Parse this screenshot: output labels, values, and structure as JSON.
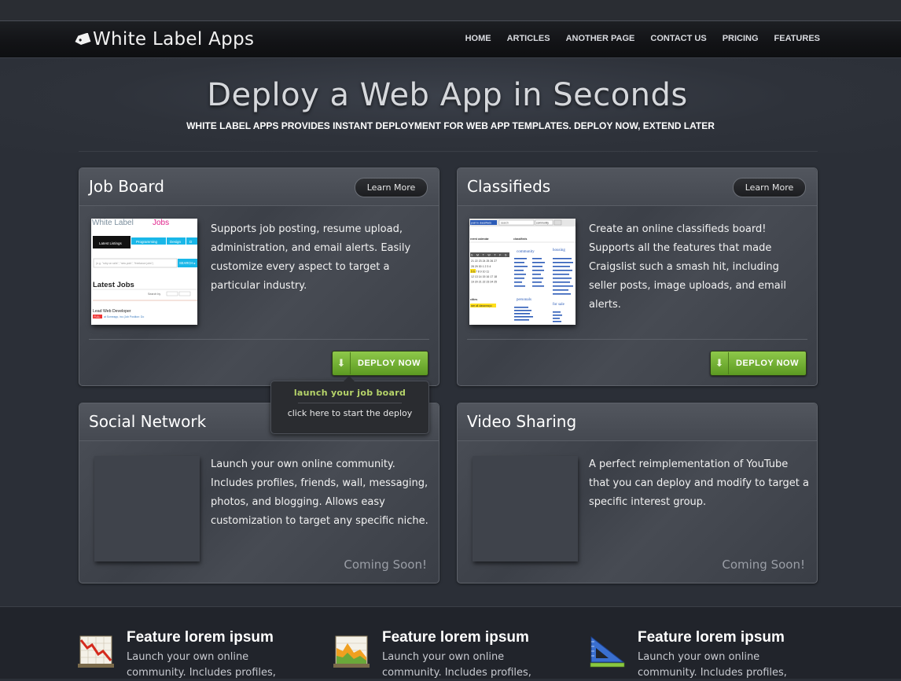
{
  "brand": {
    "name": "White Label Apps",
    "icon": "tag-icon"
  },
  "nav": {
    "items": [
      "HOME",
      "ARTICLES",
      "ANOTHER PAGE",
      "CONTACT US",
      "PRICING",
      "FEATURES"
    ]
  },
  "hero": {
    "title": "Deploy a Web App in Seconds",
    "subtitle": "WHITE LABEL APPS PROVIDES INSTANT DEPLOYMENT FOR WEB APP TEMPLATES. DEPLOY NOW, EXTEND LATER"
  },
  "cards": [
    {
      "title": "Job Board",
      "learn_more": "Learn More",
      "description": "Supports job posting, resume upload, administration, and email alerts. Easily customize every aspect to target a particular industry.",
      "action": "DEPLOY NOW",
      "thumb": {
        "logo_a": "White Label",
        "logo_b": "Jobs",
        "tabs": [
          "Latest Listings",
          "Programming",
          "Design",
          "D"
        ],
        "search_placeholder": "(e.g. \"ruby on rails\", \"new york\", \"freelance jobs\")",
        "search_button": "SEARCH ▸",
        "heading": "Latest Jobs",
        "search_by": "Search by",
        "listing_title": "Lead Web Developer",
        "listing_tag": "FULL",
        "listing_meta": "at Someapp, inc (Job Position: Do"
      }
    },
    {
      "title": "Classifieds",
      "learn_more": "Learn More",
      "description": "Create an online classifieds board! Supports all the features that made Craigslist such a smash hit, including seller posts, image uploads, and email alerts.",
      "action": "DEPLOY NOW",
      "thumb": {
        "post_btn": "post to classifieds",
        "search_ph": "search",
        "community_sel": "community",
        "col_events": "event calendar",
        "col_classifieds": "classifieds",
        "cal_head": "SMTWTFS",
        "cal_rows": [
          "21 22 23 24 25 26 27",
          "28 29 30 1 2 3 4",
          "5 6 7 8 9 10 11",
          "12 13 14 15 16 17 18",
          "19 20 21 22 23 24 25"
        ],
        "community": "community",
        "housing": "housing",
        "personals": "personals",
        "for_sale": "for sale",
        "cities": "cities",
        "all_cities": "see all classnewyo"
      }
    },
    {
      "title": "Social Network",
      "description": "Launch your own online community. Includes profiles, friends, wall, messaging, photos, and blogging. Allows easy customization to target any specific niche.",
      "status": "Coming Soon!"
    },
    {
      "title": "Video Sharing",
      "description": "A perfect reimplementation of YouTube that you can deploy and modify to target a specific interest group.",
      "status": "Coming Soon!"
    }
  ],
  "tooltip": {
    "title": "launch your job board",
    "subtitle": "click here to start the deploy"
  },
  "features": [
    {
      "icon": "line-chart-down-icon",
      "title": "Feature lorem ipsum",
      "text": "Launch your own online community. Includes profiles,"
    },
    {
      "icon": "area-chart-icon",
      "title": "Feature lorem ipsum",
      "text": "Launch your own online community. Includes profiles,"
    },
    {
      "icon": "ruler-triangle-icon",
      "title": "Feature lorem ipsum",
      "text": "Launch your own online community. Includes profiles,"
    }
  ],
  "colors": {
    "background": "#2b2f37",
    "deploy_green": "#6eac2e",
    "tooltip_title": "#b6d46a",
    "coming_soon": "#9a9ea6"
  }
}
